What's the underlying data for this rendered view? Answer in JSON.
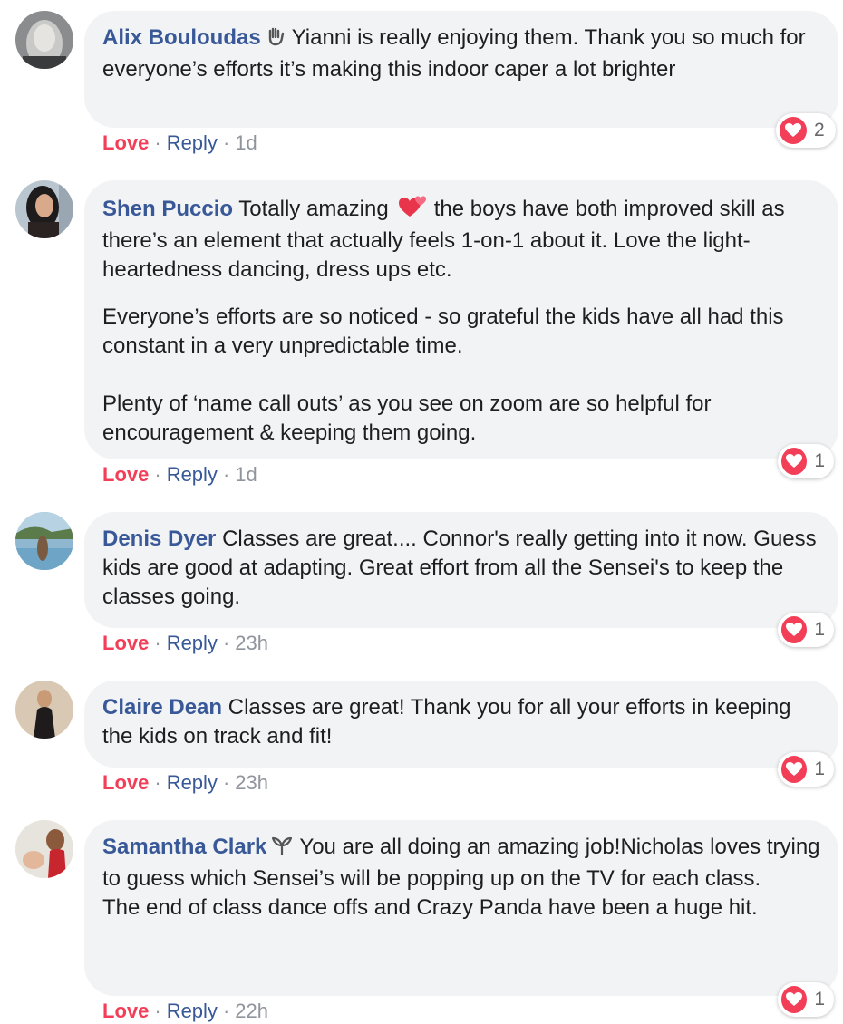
{
  "colors": {
    "author": "#385898",
    "love": "#f33e58",
    "bubble": "#f2f3f5",
    "meta": "#90949c"
  },
  "comments": [
    {
      "author": "Alix Bouloudas",
      "badge_icon": "waving-hand-icon",
      "paragraphs": [
        "Yianni is really enjoying them. Thank you so much for everyone’s efforts it’s making this indoor caper a lot brighter"
      ],
      "reaction_icon": "heart-icon",
      "reaction_count": "2",
      "love": "Love",
      "reply": "Reply",
      "time": "1d"
    },
    {
      "author": "Shen Puccio",
      "paragraphs": [
        "Totally amazing",
        "the boys have both improved skill as there’s an element that actually feels 1-on-1 about it. Love the light-heartedness dancing, dress ups etc.",
        "Everyone’s efforts are so noticed - so grateful the kids have all had this constant in a very unpredictable time.",
        "Plenty of ‘name call outs’ as you see on zoom are so helpful for encouragement & keeping them going."
      ],
      "inline_emoji": "two-hearts-icon",
      "reaction_icon": "heart-icon",
      "reaction_count": "1",
      "love": "Love",
      "reply": "Reply",
      "time": "1d"
    },
    {
      "author": "Denis Dyer",
      "paragraphs": [
        "Classes are great.... Connor's really getting into it now. Guess kids are good at adapting. Great effort from all the Sensei's to keep the classes going."
      ],
      "reaction_icon": "heart-icon",
      "reaction_count": "1",
      "love": "Love",
      "reply": "Reply",
      "time": "23h"
    },
    {
      "author": "Claire Dean",
      "paragraphs": [
        "Classes are great! Thank you for all your efforts in keeping the kids on track and fit!"
      ],
      "reaction_icon": "heart-icon",
      "reaction_count": "1",
      "love": "Love",
      "reply": "Reply",
      "time": "23h"
    },
    {
      "author": "Samantha Clark",
      "badge_icon": "sprout-icon",
      "paragraphs": [
        "You are all doing an amazing job!Nicholas loves trying to guess which Sensei’s will be popping up on the TV for each class.",
        "The end of class dance offs and Crazy Panda have been a huge hit."
      ],
      "reaction_icon": "heart-icon",
      "reaction_count": "1",
      "love": "Love",
      "reply": "Reply",
      "time": "22h"
    }
  ]
}
